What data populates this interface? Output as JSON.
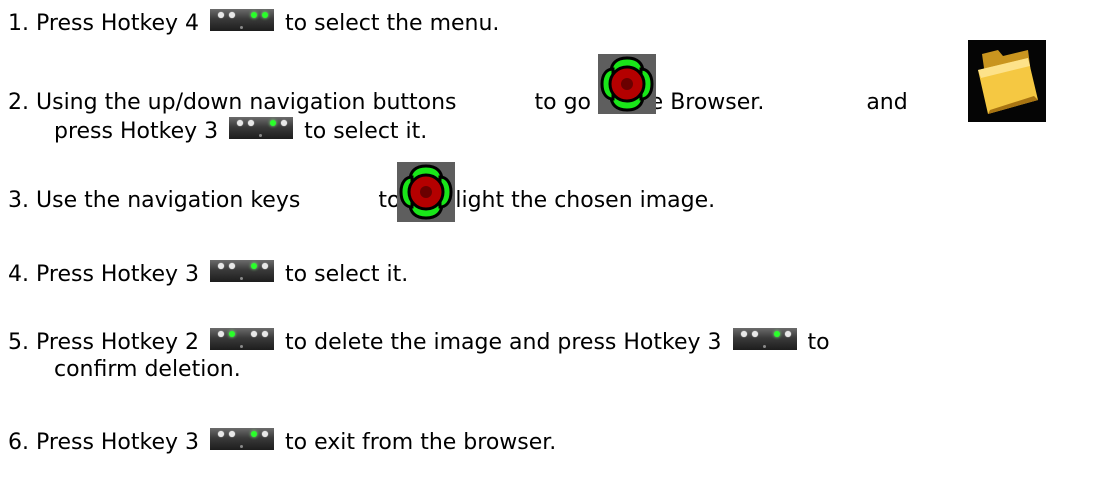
{
  "steps": [
    {
      "number": "1.",
      "parts": [
        "Press Hotkey 4",
        "to select the menu."
      ]
    },
    {
      "number": "2.",
      "parts": [
        "Using the up/down navigation buttons",
        "to go to the Browser.",
        "and"
      ]
    },
    {
      "number": "",
      "parts": [
        "press Hotkey 3",
        "to select it."
      ]
    },
    {
      "number": "3.",
      "parts": [
        "Use the navigation keys",
        "to highlight the chosen image."
      ]
    },
    {
      "number": "4.",
      "parts": [
        "Press Hotkey 3",
        "to select it."
      ]
    },
    {
      "number": "5.",
      "parts": [
        "Press Hotkey 2",
        "to delete the image and press Hotkey 3",
        "to"
      ]
    },
    {
      "number": "",
      "parts": [
        "confirm deletion."
      ]
    },
    {
      "number": "6.",
      "parts": [
        "Press Hotkey 3",
        "to exit from the browser."
      ]
    }
  ],
  "icons": {
    "hotkey_strip": "hotkey-strip-icon",
    "navigation_pad": "navigation-pad-icon",
    "folder": "folder-icon"
  },
  "colors": {
    "hotkey_active": "#2aff2a",
    "hotkey_inactive": "#e8e8e8",
    "nav_arrow": "#19e619",
    "nav_center": "#b40000",
    "folder": "#f5c842"
  }
}
